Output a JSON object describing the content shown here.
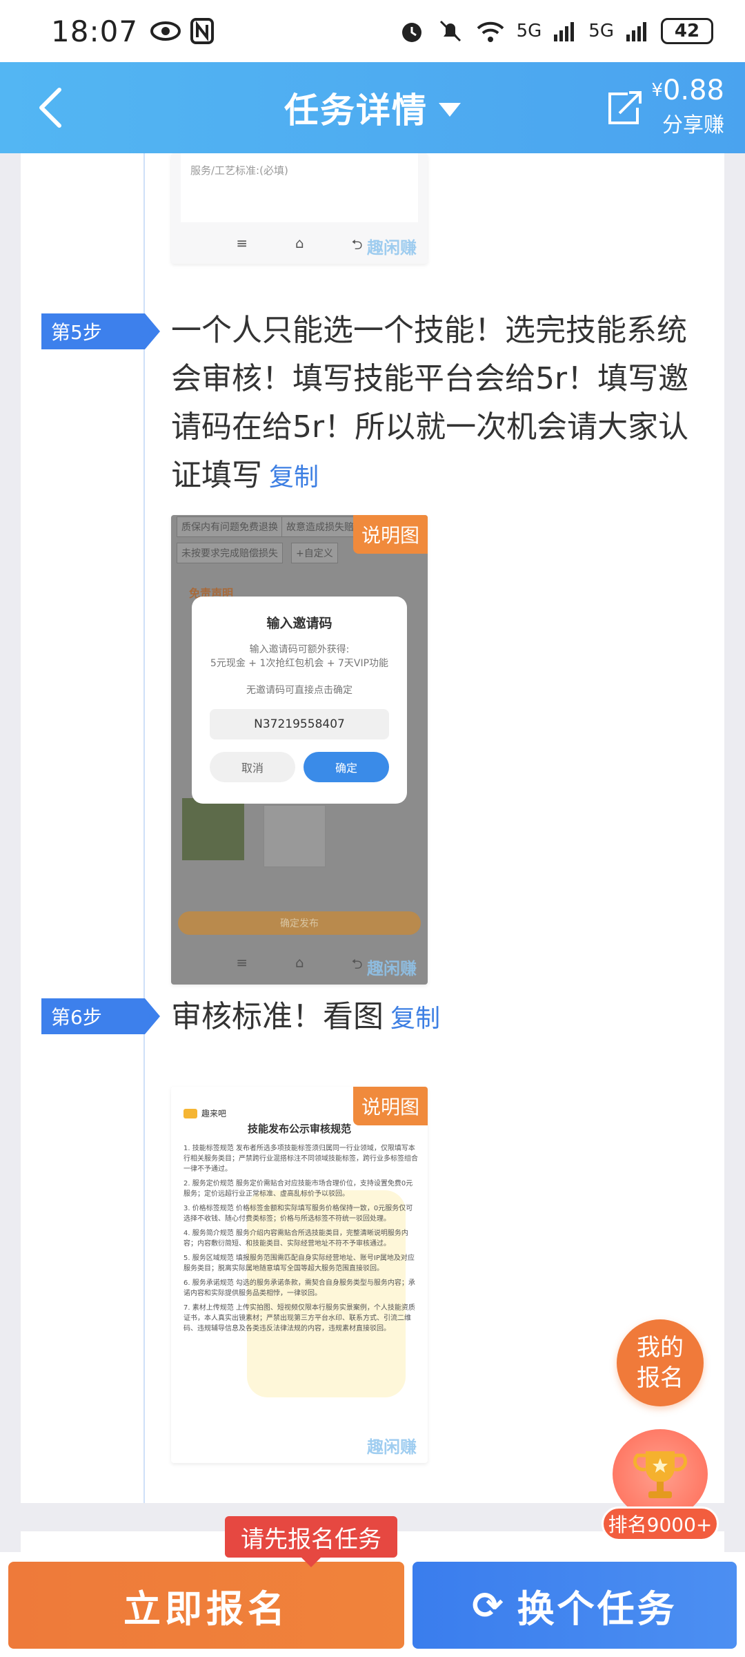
{
  "status_bar": {
    "time": "18:07",
    "network_1": "5G",
    "network_2": "5G",
    "battery": "42"
  },
  "header": {
    "title": "任务详情",
    "share_amount": "0.88",
    "share_currency": "¥",
    "share_label": "分享赚"
  },
  "shot_top": {
    "field_hint": "服务/工艺标准:(必填)",
    "watermark": "趣闲赚"
  },
  "step5": {
    "tag": "第5步",
    "text": "一个人只能选一个技能！选完技能系统会审核！填写技能平台会给5r！填写邀请码在给5r！所以就一次机会请大家认证填写",
    "copy": "复制",
    "image_badge": "说明图",
    "bg_chips": [
      "质保内有问题免费退换",
      "故意造成损失赔偿",
      "未按要求完成赔偿损失",
      "+自定义"
    ],
    "bg_section": "免责声明",
    "bg_button": "确定发布",
    "dialog": {
      "title": "输入邀请码",
      "desc_line1": "输入邀请码可额外获得:",
      "desc_line2": "5元现金 + 1次抢红包机会 + 7天VIP功能",
      "note": "无邀请码可直接点击确定",
      "code": "N37219558407",
      "cancel": "取消",
      "confirm": "确定"
    },
    "watermark": "趣闲赚"
  },
  "step6": {
    "tag": "第6步",
    "text": "审核标准！看图",
    "copy": "复制",
    "image_badge": "说明图",
    "doc": {
      "brand": "趣来吧",
      "title": "技能发布公示审核规范",
      "sections": [
        "1. 技能标签规范\n发布者所选多项技能标签须归属同一行业领域，仅限填写本行相关服务类目；严禁跨行业混搭标注不同领域技能标签，跨行业多标签组合一律不予通过。",
        "2. 服务定价规范\n服务定价需贴合对应技能市场合理价位，支持设置免费0元服务；定价远超行业正常标准、虚高乱标价予以驳回。",
        "3. 价格标签规范\n价格标签金额和实际填写服务价格保持一致，0元服务仅可选择不收钱、随心付费类标签；价格与所选标签不符统一驳回处理。",
        "4. 服务简介规范\n服务介绍内容需贴合所选技能类目，完整清晰说明服务内容；内容敷衍简短、和技能类目、实际经营地址不符不予审核通过。",
        "5. 服务区域规范\n填报服务范围需匹配自身实际经营地址、账号IP属地及对应服务类目；脱离实际属地随意填写全国等超大服务范围直接驳回。",
        "6. 服务承诺规范\n勾选的服务承诺条款，需契合自身服务类型与服务内容；承诺内容和实际提供服务品类相悖，一律驳回。",
        "7. 素材上传规范\n上传实拍图、短视频仅限本行服务实景案例，个人技能资质证书，本人真实出镜素材；严禁出现第三方平台水印、联系方式、引流二维码、违规辅导信息及各类违反法律法规的内容，违规素材直接驳回。"
      ]
    },
    "watermark": "趣闲赚"
  },
  "floating": {
    "my_registration": "我的报名",
    "rank": "排名9000+"
  },
  "bottom": {
    "tooltip": "请先报名任务",
    "signup": "立即报名",
    "change": "换个任务"
  },
  "colors": {
    "header_blue": "#4aa3ef",
    "step_blue": "#3d80ec",
    "orange": "#ee7a3a",
    "tooltip_red": "#e64841"
  }
}
